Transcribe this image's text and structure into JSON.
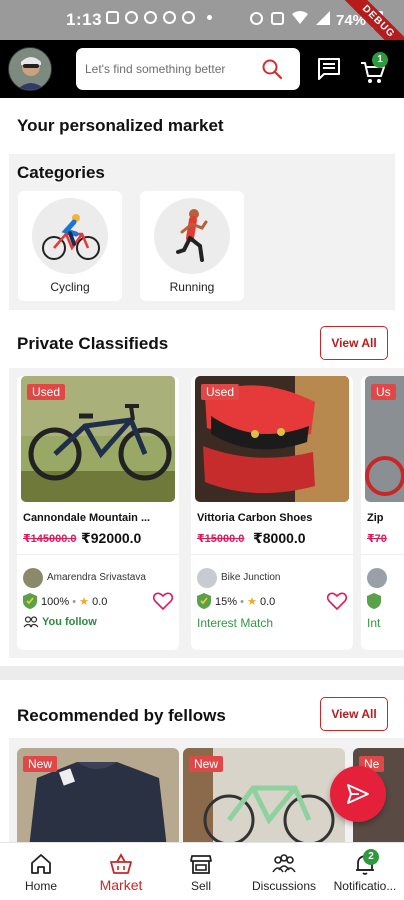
{
  "status_bar": {
    "time": "1:13",
    "battery": "74%",
    "debug_banner": "DEBUG"
  },
  "header": {
    "search_placeholder": "Let's find something better",
    "cart_count": "1"
  },
  "page": {
    "title": "Your personalized market"
  },
  "categories": {
    "title": "Categories",
    "items": [
      {
        "label": "Cycling",
        "icon": "cyclist-icon"
      },
      {
        "label": "Running",
        "icon": "runner-icon"
      }
    ]
  },
  "private_classifieds": {
    "title": "Private Classifieds",
    "view_all": "View All",
    "cards": [
      {
        "tag": "Used",
        "name": "Cannondale Mountain ...",
        "old_price": "₹145000.0",
        "new_price": "₹92000.0",
        "seller": "Amarendra Srivastava",
        "trust": "100%",
        "rating": "0.0",
        "footer": "You follow"
      },
      {
        "tag": "Used",
        "name": "Vittoria Carbon Shoes",
        "old_price": "₹15000.0",
        "new_price": "₹8000.0",
        "seller": "Bike Junction",
        "trust": "15%",
        "rating": "0.0",
        "footer": "Interest Match"
      },
      {
        "tag": "Us",
        "name": "Zip",
        "old_price": "₹70",
        "footer": "Int"
      }
    ]
  },
  "recommended": {
    "title": "Recommended by fellows",
    "view_all": "View All",
    "tags": [
      "New",
      "New",
      "Ne"
    ]
  },
  "bottom_nav": {
    "items": [
      {
        "label": "Home",
        "icon": "home-icon"
      },
      {
        "label": "Market",
        "icon": "market-basket-icon",
        "active": true
      },
      {
        "label": "Sell",
        "icon": "shop-icon"
      },
      {
        "label": "Discussions",
        "icon": "discussions-group-icon"
      },
      {
        "label": "Notificatio...",
        "icon": "bell-icon",
        "badge": "2"
      }
    ]
  },
  "colors": {
    "accent": "#c62828",
    "price_strike": "#e0195d",
    "success": "#2e9a3e",
    "header_bg": "#000000"
  }
}
